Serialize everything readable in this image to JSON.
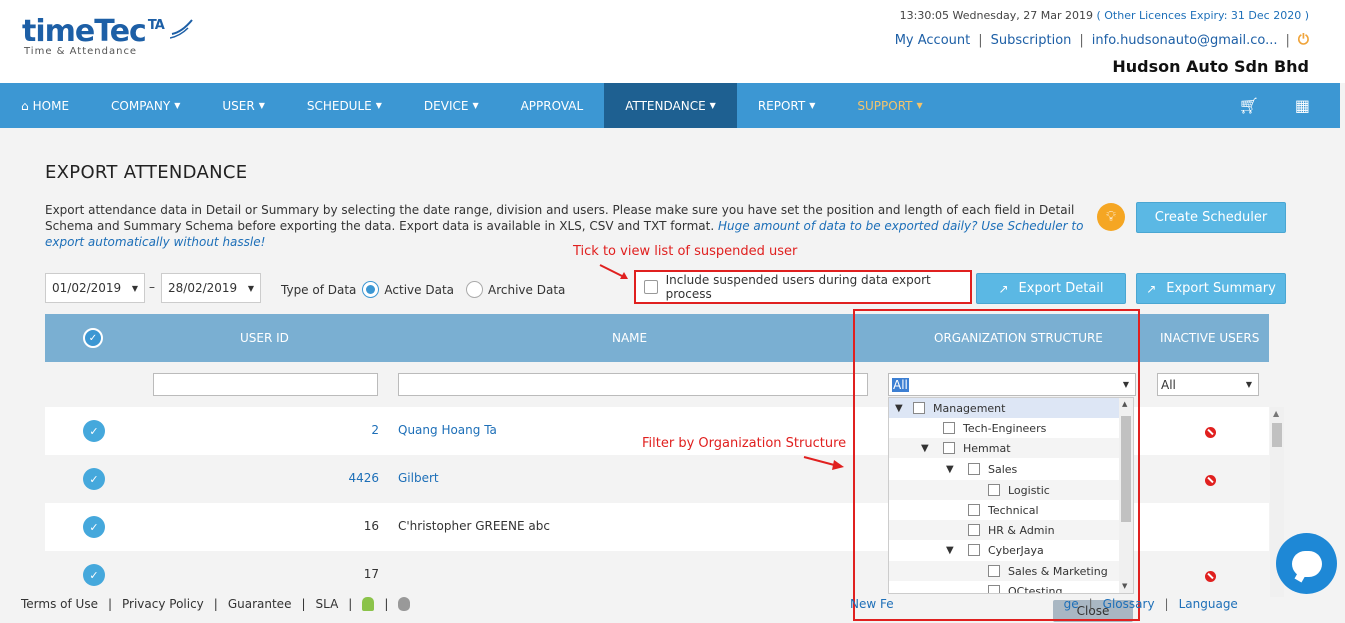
{
  "header": {
    "logo_text": "timeTec",
    "logo_ta": "TA",
    "logo_sub": "Time & Attendance",
    "datetime": "13:30:05 Wednesday, 27 Mar 2019",
    "licence": "( Other Licences Expiry:  31 Dec 2020 )",
    "links": [
      "My Account",
      "Subscription",
      "info.hudsonauto@gmail.co..."
    ],
    "company": "Hudson Auto Sdn Bhd"
  },
  "nav": {
    "items": [
      {
        "label": "HOME",
        "icon": "home-icon",
        "caret": false
      },
      {
        "label": "COMPANY",
        "caret": true
      },
      {
        "label": "USER",
        "caret": true
      },
      {
        "label": "SCHEDULE",
        "caret": true
      },
      {
        "label": "DEVICE",
        "caret": true
      },
      {
        "label": "APPROVAL",
        "caret": false
      },
      {
        "label": "ATTENDANCE",
        "caret": true,
        "active": true
      },
      {
        "label": "REPORT",
        "caret": true
      },
      {
        "label": "SUPPORT",
        "caret": true,
        "color": "#f5c46b"
      }
    ],
    "right_icons": [
      "cart-icon",
      "apps-grid-icon"
    ]
  },
  "page": {
    "title": "EXPORT ATTENDANCE",
    "description": "Export attendance data in Detail or Summary by selecting the date range, division and users. Please make sure you have set the position and length of each field in Detail Schema and Summary Schema before exporting the data. Export data is available in XLS, CSV and TXT format.",
    "hint": "Huge amount of data to be exported daily? Use Scheduler to export automatically without hassle!",
    "create_scheduler": "Create Scheduler",
    "date_from": "01/02/2019",
    "date_to": "28/02/2019",
    "date_dash": "–",
    "type_of_data_label": "Type of Data",
    "radio_active": "Active Data",
    "radio_archive": "Archive Data",
    "include_suspended": "Include suspended users during data export process",
    "export_detail": "Export Detail",
    "export_summary": "Export Summary"
  },
  "annotations": {
    "suspended_note": "Tick to view list of suspended user",
    "org_note": "Filter by Organization Structure"
  },
  "table": {
    "headers": [
      "USER ID",
      "NAME",
      "ORGANIZATION STRUCTURE",
      "INACTIVE USERS"
    ],
    "org_filter_value": "All",
    "inactive_filter_value": "All",
    "rows": [
      {
        "id": "2",
        "name": "Quang Hoang Ta",
        "link": true,
        "inactive": true
      },
      {
        "id": "4426",
        "name": "Gilbert",
        "link": true,
        "inactive": true
      },
      {
        "id": "16",
        "name": "C'hristopher GREENE abc",
        "link": false,
        "inactive": false
      },
      {
        "id": "17",
        "name": "",
        "link": false,
        "inactive": true
      }
    ]
  },
  "org_tree": {
    "items": [
      {
        "label": "Management",
        "expanded": true
      },
      {
        "label": "Tech-Engineers",
        "expanded": false
      },
      {
        "label": "Hemmat",
        "expanded": true
      },
      {
        "label": "Sales",
        "expanded": true
      },
      {
        "label": "Logistic",
        "expanded": false
      },
      {
        "label": "Technical",
        "expanded": false
      },
      {
        "label": "HR & Admin",
        "expanded": false
      },
      {
        "label": "CyberJaya",
        "expanded": true
      },
      {
        "label": "Sales & Marketing",
        "expanded": false
      },
      {
        "label": "QCtesting",
        "expanded": false
      }
    ],
    "close": "Close"
  },
  "footer": {
    "left": [
      "Terms of Use",
      "Privacy Policy",
      "Guarantee",
      "SLA"
    ],
    "right": [
      "New Fe",
      "ge",
      "Glossary",
      "Language"
    ]
  },
  "colors": {
    "nav_bg": "#3c97d3",
    "nav_active": "#1e6091",
    "table_header": "#7aafd2",
    "accent_red": "#e0201f",
    "button_blue": "#5bb8e4"
  }
}
